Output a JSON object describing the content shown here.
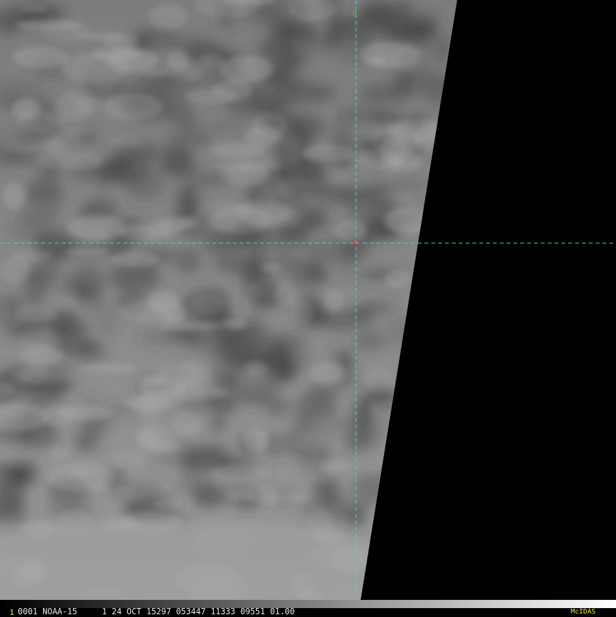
{
  "image": {
    "title": "",
    "scan_fill_color": "#8c8c8c",
    "space_color": "#000000",
    "graticule_color": "#3fd9d9"
  },
  "graticule": {
    "longitude_label": "0",
    "longitude_label_color": "#39d339",
    "latitude_label": "-15",
    "latitude_label_color": "#e03b3b"
  },
  "status_bar": {
    "frame_number": "1",
    "frame_number_color": "#f5e94a",
    "text": "0001 NOAA-15     1 24 OCT 15297 053447 11333 09551 01.00",
    "software": "McIDAS",
    "software_color": "#f5e94a"
  }
}
